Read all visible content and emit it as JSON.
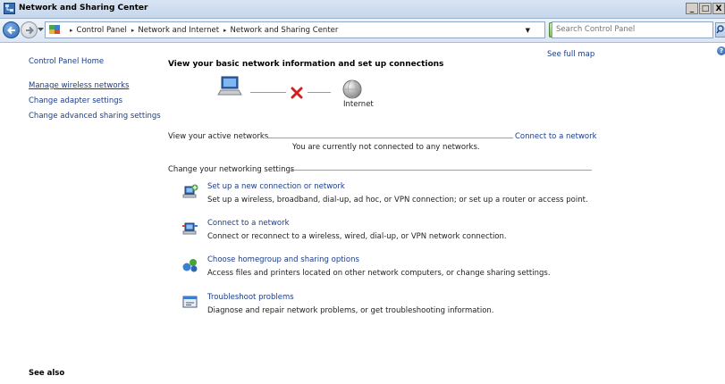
{
  "window": {
    "title": "Network and Sharing Center",
    "controls": [
      "_",
      "□",
      "X"
    ]
  },
  "address_bar": {
    "breadcrumbs": [
      "Control Panel",
      "Network and Internet",
      "Network and Sharing Center"
    ],
    "search_placeholder": "Search Control Panel"
  },
  "left_pane": {
    "home": "Control Panel Home",
    "links": {
      "manage_wireless": "Manage wireless networks",
      "adapter": "Change adapter settings",
      "advanced_sharing": "Change advanced sharing settings"
    },
    "see_also": "See also"
  },
  "main": {
    "heading": "View your basic network information and set up connections",
    "see_full_map": "See full map",
    "internet_label": "Internet",
    "active_networks_label": "View your active networks",
    "connect_link": "Connect to a network",
    "not_connected": "You are currently not connected to any networks.",
    "change_settings_label": "Change your networking settings",
    "tasks": [
      {
        "icon": "new-connection-icon",
        "title": "Set up a new connection or network",
        "desc": "Set up a wireless, broadband, dial-up, ad hoc, or VPN connection; or set up a router or access point."
      },
      {
        "icon": "connect-network-icon",
        "title": "Connect to a network",
        "desc": "Connect or reconnect to a wireless, wired, dial-up, or VPN network connection."
      },
      {
        "icon": "homegroup-icon",
        "title": "Choose homegroup and sharing options",
        "desc": "Access files and printers located on other network computers, or change sharing settings."
      },
      {
        "icon": "troubleshoot-icon",
        "title": "Troubleshoot problems",
        "desc": "Diagnose and repair network problems, or get troubleshooting information."
      }
    ]
  },
  "colors": {
    "link": "#1a3c8a",
    "titlebar": "#c5d6ec",
    "disconnected_x": "#d21f1f"
  }
}
